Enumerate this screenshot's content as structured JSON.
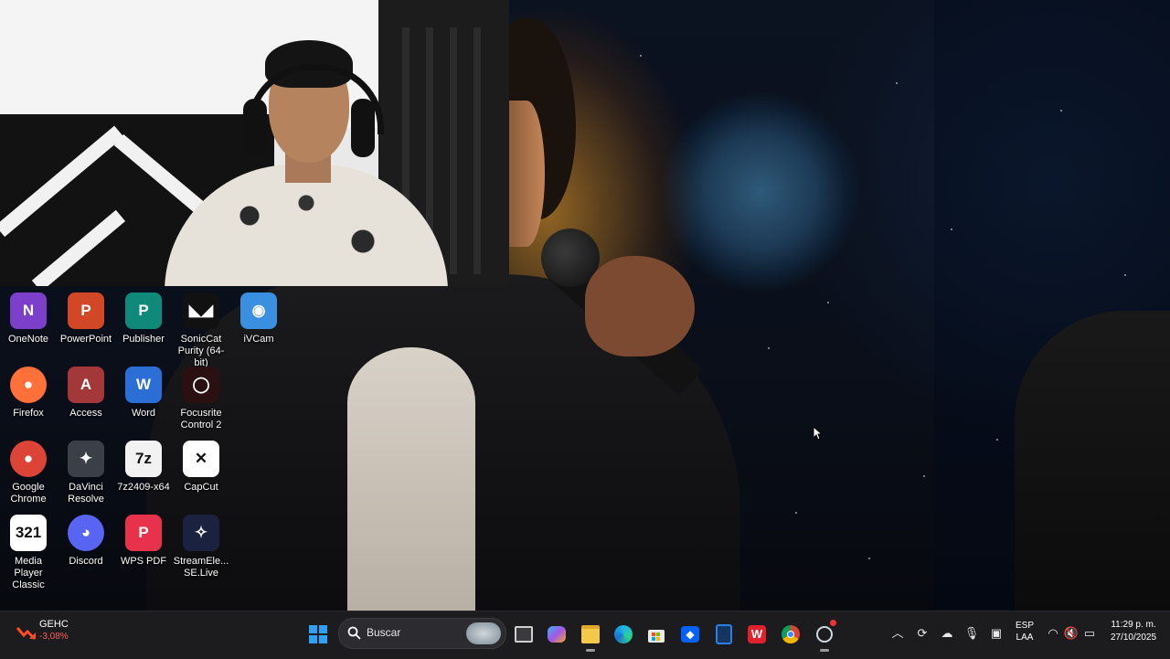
{
  "desktop_icons": [
    {
      "label": "OneNote",
      "icon": "onenote-icon",
      "glyph": "N",
      "color": "#7b3fc9"
    },
    {
      "label": "PowerPoint",
      "icon": "powerpoint-icon",
      "glyph": "P",
      "color": "#d24726"
    },
    {
      "label": "Publisher",
      "icon": "publisher-icon",
      "glyph": "P",
      "color": "#0f8a7a"
    },
    {
      "label": "SonicCat Purity (64-bit)",
      "icon": "soniccat-icon",
      "glyph": "◣◢",
      "color": "#111111"
    },
    {
      "label": "iVCam",
      "icon": "ivcam-icon",
      "glyph": "◉",
      "color": "#3b8fe0"
    },
    {
      "label": "Firefox",
      "icon": "firefox-icon",
      "glyph": "●",
      "color": "#ff7139"
    },
    {
      "label": "Access",
      "icon": "access-icon",
      "glyph": "A",
      "color": "#a4373a"
    },
    {
      "label": "Word",
      "icon": "word-icon",
      "glyph": "W",
      "color": "#2b6fd6"
    },
    {
      "label": "Focusrite Control 2",
      "icon": "focusrite-icon",
      "glyph": "◯",
      "color": "#2a1010"
    },
    {
      "label": "Google Chrome",
      "icon": "chrome-icon",
      "glyph": "●",
      "color": "#db4437"
    },
    {
      "label": "DaVinci Resolve",
      "icon": "davinci-icon",
      "glyph": "✦",
      "color": "#3a3f48"
    },
    {
      "label": "7z2409-x64",
      "icon": "7zip-icon",
      "glyph": "7z",
      "color": "#f2f2f2"
    },
    {
      "label": "CapCut",
      "icon": "capcut-icon",
      "glyph": "✕",
      "color": "#ffffff"
    },
    {
      "label": "Media Player Classic",
      "icon": "mpc-icon",
      "glyph": "321",
      "color": "#ffffff"
    },
    {
      "label": "Discord",
      "icon": "discord-icon",
      "glyph": "◕",
      "color": "#5865f2"
    },
    {
      "label": "WPS PDF",
      "icon": "wps-pdf-icon",
      "glyph": "P",
      "color": "#e8314a"
    },
    {
      "label": "StreamEle... SE.Live",
      "icon": "streamelements-icon",
      "glyph": "✧",
      "color": "#1b2240"
    }
  ],
  "taskbar": {
    "stock": {
      "ticker": "GEHC",
      "change": "-3,08%",
      "change_color": "#ff5c5c"
    },
    "search_placeholder": "Buscar",
    "pinned": [
      "start-icon",
      "task-view-icon",
      "copilot-icon",
      "file-explorer-icon",
      "edge-icon",
      "microsoft-store-icon",
      "dropbox-icon",
      "app-icon",
      "wps-office-icon",
      "chrome-icon",
      "steam-icon"
    ],
    "language": {
      "line1": "ESP",
      "line2": "LAA"
    },
    "clock": {
      "time": "11:29 p. m.",
      "date": "27/10/2025"
    }
  }
}
